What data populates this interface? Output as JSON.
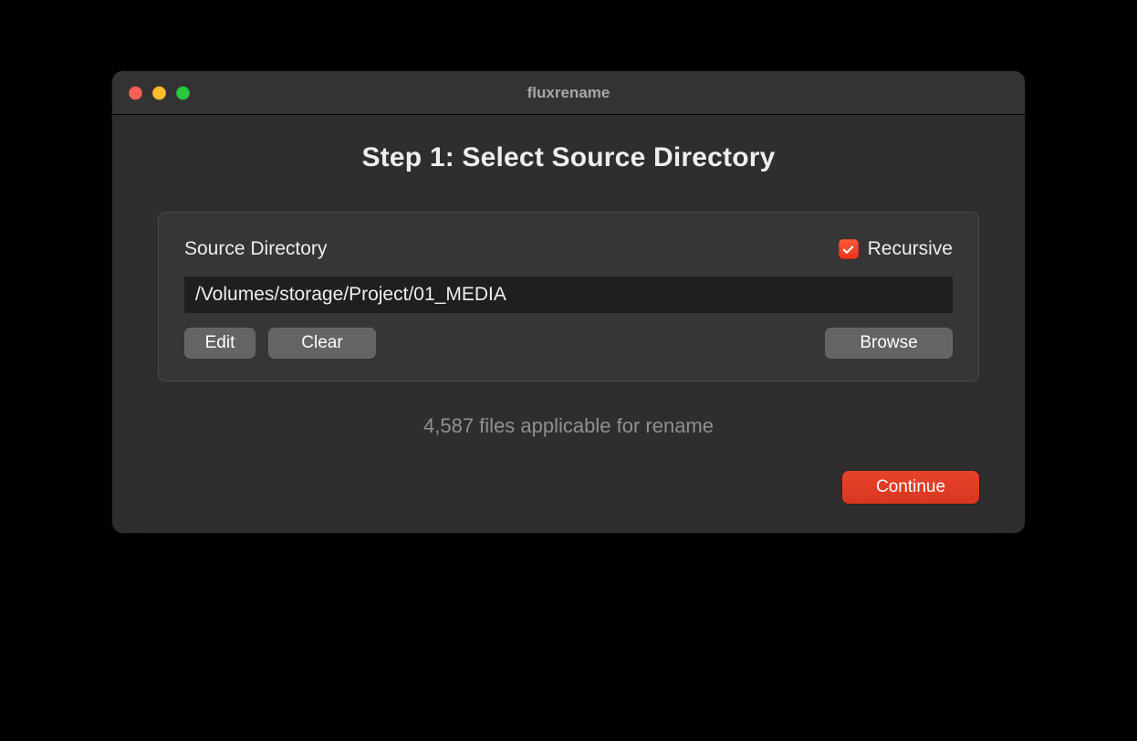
{
  "window": {
    "title": "fluxrename"
  },
  "heading": "Step 1: Select Source Directory",
  "panel": {
    "label": "Source Directory",
    "recursive_label": "Recursive",
    "recursive_checked": true,
    "path_value": "/Volumes/storage/Project/01_MEDIA",
    "buttons": {
      "edit": "Edit",
      "clear": "Clear",
      "browse": "Browse"
    }
  },
  "status": "4,587 files applicable for rename",
  "footer": {
    "continue": "Continue"
  }
}
